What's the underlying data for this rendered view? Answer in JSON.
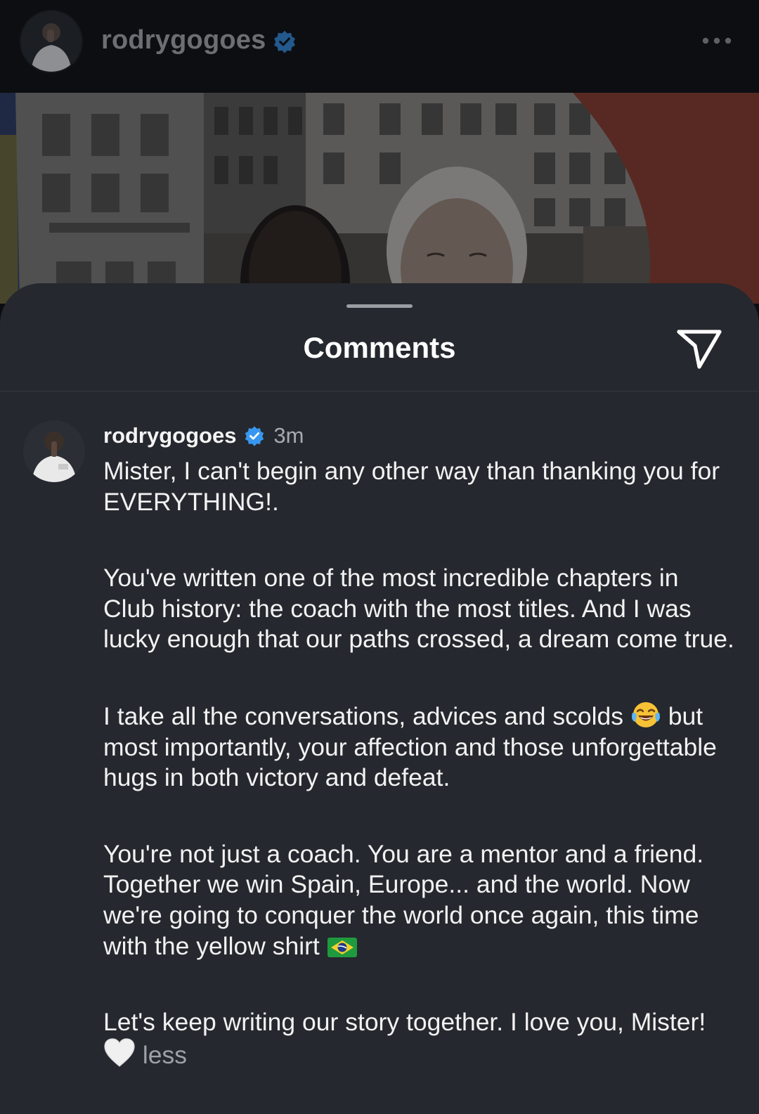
{
  "post": {
    "username": "rodrygogoes"
  },
  "sheet": {
    "title": "Comments"
  },
  "comment": {
    "username": "rodrygogoes",
    "time": "3m",
    "p1": "Mister, I can't begin any other way than thanking you for EVERYTHING!.",
    "p2": "You've written one of the most incredible chapters in Club history: the coach with the most titles. And I was lucky enough that our paths crossed, a dream come true.",
    "p3_before": "I take all the conversations, advices and scolds",
    "p3_after": "but most importantly, your affection and those unforgettable hugs in both victory and defeat.",
    "p4": "You're not just a coach. You are a mentor and a friend. Together we win Spain, Europe... and the world. Now we're going to conquer the world once again, this time with the yellow shirt",
    "p5": "Let's keep writing our story together. I love you, Mister!",
    "less_label": "less"
  },
  "icons": {
    "verified": "verified-badge-icon",
    "more": "more-options-icon",
    "share": "send-paper-plane-icon",
    "emoji_laugh": "face-with-tears-of-joy-emoji",
    "emoji_flag": "brazil-flag-emoji",
    "emoji_heart": "white-heart-emoji"
  },
  "colors": {
    "verified_blue": "#3797f0",
    "sheet_background": "#25282e",
    "header_background": "#0c0e12"
  }
}
